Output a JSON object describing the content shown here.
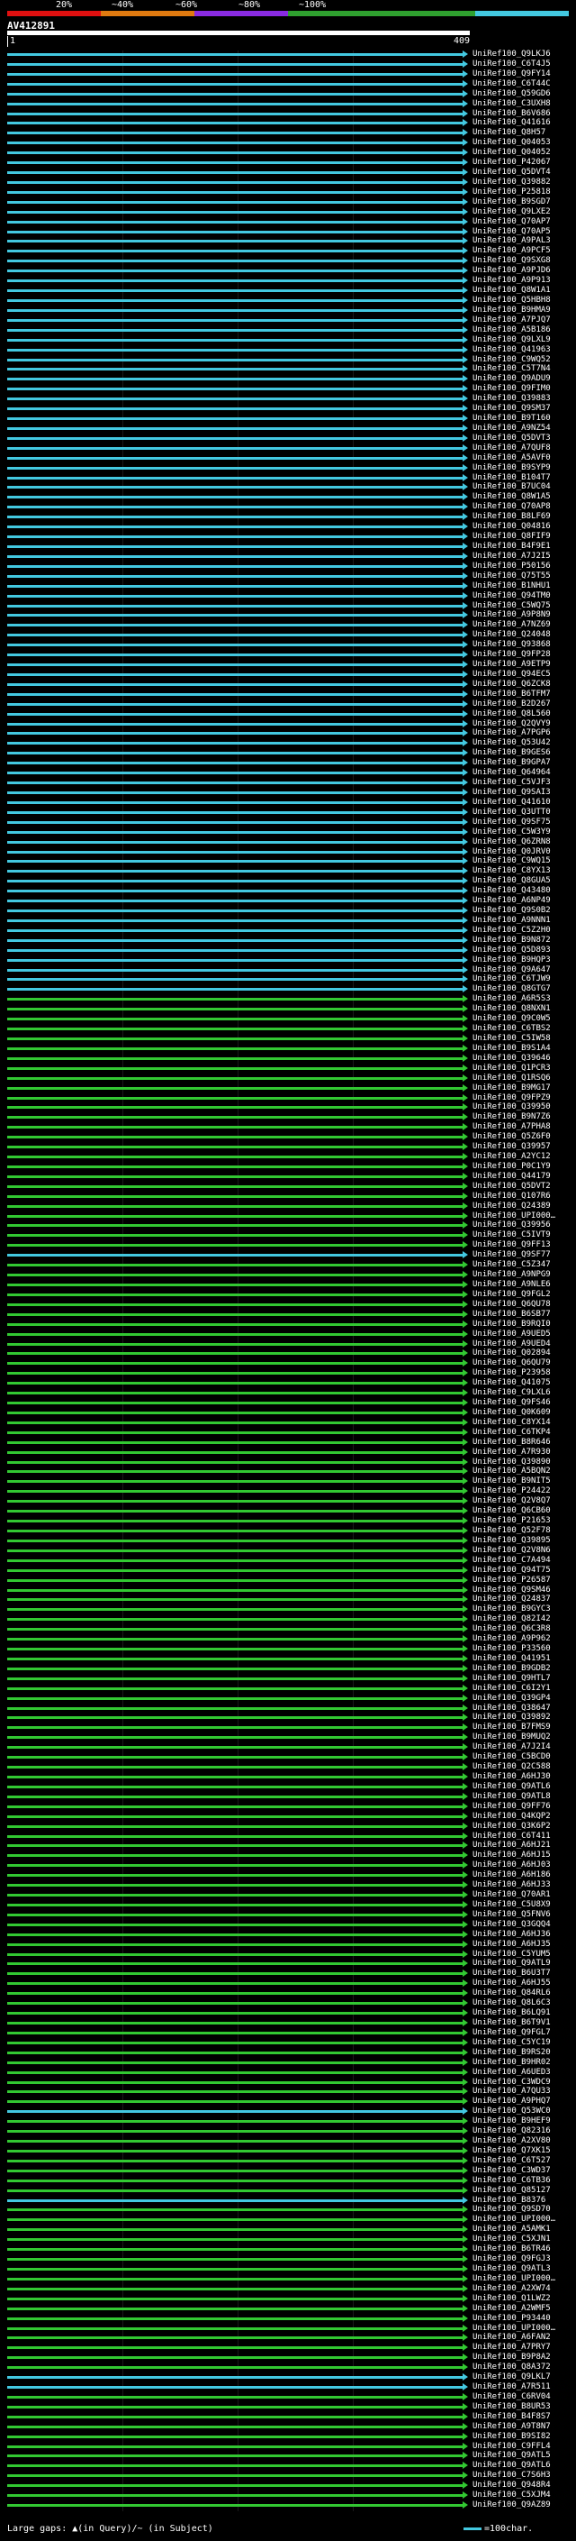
{
  "scale": {
    "labels": [
      "20%",
      "~40%",
      "~60%",
      "~80%",
      "~100%"
    ],
    "colors": [
      "#e01010",
      "#e07a10",
      "#8a2be2",
      "#2fa02f",
      "#2fa02f",
      "#43c8e0"
    ]
  },
  "query": {
    "title": "AV412891",
    "start": "1",
    "end": "409"
  },
  "legend": {
    "left": "Large gaps: ▲(in Query)/~ (in Subject)",
    "right": "=100char."
  },
  "colors": {
    "blue": "#43c8e0",
    "green": "#32c832"
  },
  "hits": [
    {
      "name": "UniRef100_Q9LKJ6",
      "c": "blue"
    },
    {
      "name": "UniRef100_C6T4J5",
      "c": "blue"
    },
    {
      "name": "UniRef100_Q9FY14",
      "c": "blue"
    },
    {
      "name": "UniRef100_C6T44C",
      "c": "blue"
    },
    {
      "name": "UniRef100_Q59GD6",
      "c": "blue"
    },
    {
      "name": "UniRef100_C3UXH8",
      "c": "blue"
    },
    {
      "name": "UniRef100_B6V686",
      "c": "blue"
    },
    {
      "name": "UniRef100_Q41616",
      "c": "blue"
    },
    {
      "name": "UniRef100_Q8H57",
      "c": "blue"
    },
    {
      "name": "UniRef100_Q04053",
      "c": "blue"
    },
    {
      "name": "UniRef100_Q04052",
      "c": "blue"
    },
    {
      "name": "UniRef100_P42067",
      "c": "blue"
    },
    {
      "name": "UniRef100_Q5DVT4",
      "c": "blue"
    },
    {
      "name": "UniRef100_Q39882",
      "c": "blue"
    },
    {
      "name": "UniRef100_P25818",
      "c": "blue"
    },
    {
      "name": "UniRef100_B9SGD7",
      "c": "blue"
    },
    {
      "name": "UniRef100_Q9LXE2",
      "c": "blue"
    },
    {
      "name": "UniRef100_Q70AP7",
      "c": "blue"
    },
    {
      "name": "UniRef100_Q70AP5",
      "c": "blue"
    },
    {
      "name": "UniRef100_A9PAL3",
      "c": "blue"
    },
    {
      "name": "UniRef100_A9PCF5",
      "c": "blue"
    },
    {
      "name": "UniRef100_Q9SXG8",
      "c": "blue"
    },
    {
      "name": "UniRef100_A9PJD6",
      "c": "blue"
    },
    {
      "name": "UniRef100_A9P913",
      "c": "blue"
    },
    {
      "name": "UniRef100_Q8W1A1",
      "c": "blue"
    },
    {
      "name": "UniRef100_Q5HBH8",
      "c": "blue"
    },
    {
      "name": "UniRef100_B9HMA9",
      "c": "blue"
    },
    {
      "name": "UniRef100_A7PJQ7",
      "c": "blue"
    },
    {
      "name": "UniRef100_A5B186",
      "c": "blue"
    },
    {
      "name": "UniRef100_Q9LXL9",
      "c": "blue"
    },
    {
      "name": "UniRef100_Q41963",
      "c": "blue"
    },
    {
      "name": "UniRef100_C9WQ52",
      "c": "blue"
    },
    {
      "name": "UniRef100_C5T7N4",
      "c": "blue"
    },
    {
      "name": "UniRef100_Q9ADU9",
      "c": "blue"
    },
    {
      "name": "UniRef100_Q9FIM0",
      "c": "blue"
    },
    {
      "name": "UniRef100_Q39883",
      "c": "blue"
    },
    {
      "name": "UniRef100_Q9SM37",
      "c": "blue"
    },
    {
      "name": "UniRef100_B9T160",
      "c": "blue"
    },
    {
      "name": "UniRef100_A9NZ54",
      "c": "blue"
    },
    {
      "name": "UniRef100_Q5DVT3",
      "c": "blue"
    },
    {
      "name": "UniRef100_A7QUF8",
      "c": "blue"
    },
    {
      "name": "UniRef100_A5AVF0",
      "c": "blue"
    },
    {
      "name": "UniRef100_B9SYP9",
      "c": "blue"
    },
    {
      "name": "UniRef100_B104T7",
      "c": "blue"
    },
    {
      "name": "UniRef100_B7UC04",
      "c": "blue"
    },
    {
      "name": "UniRef100_Q8W1A5",
      "c": "blue"
    },
    {
      "name": "UniRef100_Q70AP8",
      "c": "blue"
    },
    {
      "name": "UniRef100_B8LF69",
      "c": "blue"
    },
    {
      "name": "UniRef100_Q04816",
      "c": "blue"
    },
    {
      "name": "UniRef100_Q8FIF9",
      "c": "blue"
    },
    {
      "name": "UniRef100_B4F9E1",
      "c": "blue"
    },
    {
      "name": "UniRef100_A7J2I5",
      "c": "blue"
    },
    {
      "name": "UniRef100_P50156",
      "c": "blue"
    },
    {
      "name": "UniRef100_Q75T55",
      "c": "blue"
    },
    {
      "name": "UniRef100_B1NHU1",
      "c": "blue"
    },
    {
      "name": "UniRef100_Q94TM0",
      "c": "blue"
    },
    {
      "name": "UniRef100_C5WQ75",
      "c": "blue"
    },
    {
      "name": "UniRef100_A9P8N9",
      "c": "blue"
    },
    {
      "name": "UniRef100_A7NZ69",
      "c": "blue"
    },
    {
      "name": "UniRef100_Q24048",
      "c": "blue"
    },
    {
      "name": "UniRef100_Q93868",
      "c": "blue"
    },
    {
      "name": "UniRef100_Q9FP28",
      "c": "blue"
    },
    {
      "name": "UniRef100_A9ETP9",
      "c": "blue"
    },
    {
      "name": "UniRef100_Q94EC5",
      "c": "blue"
    },
    {
      "name": "UniRef100_Q6ZCK8",
      "c": "blue"
    },
    {
      "name": "UniRef100_B6TFM7",
      "c": "blue"
    },
    {
      "name": "UniRef100_B2D267",
      "c": "blue"
    },
    {
      "name": "UniRef100_Q8L560",
      "c": "blue"
    },
    {
      "name": "UniRef100_Q2QVY9",
      "c": "blue"
    },
    {
      "name": "UniRef100_A7PGP6",
      "c": "blue"
    },
    {
      "name": "UniRef100_Q53U42",
      "c": "blue"
    },
    {
      "name": "UniRef100_B9GES6",
      "c": "blue"
    },
    {
      "name": "UniRef100_B9GPA7",
      "c": "blue"
    },
    {
      "name": "UniRef100_Q64964",
      "c": "blue"
    },
    {
      "name": "UniRef100_C5VJF3",
      "c": "blue"
    },
    {
      "name": "UniRef100_Q9SAI3",
      "c": "blue"
    },
    {
      "name": "UniRef100_Q41610",
      "c": "blue"
    },
    {
      "name": "UniRef100_Q3UTT0",
      "c": "blue"
    },
    {
      "name": "UniRef100_Q9SF75",
      "c": "blue"
    },
    {
      "name": "UniRef100_C5W3Y9",
      "c": "blue"
    },
    {
      "name": "UniRef100_Q6ZRN8",
      "c": "blue"
    },
    {
      "name": "UniRef100_Q0JRV0",
      "c": "blue"
    },
    {
      "name": "UniRef100_C9WQ15",
      "c": "blue"
    },
    {
      "name": "UniRef100_C8YX13",
      "c": "blue"
    },
    {
      "name": "UniRef100_Q8GUA5",
      "c": "blue"
    },
    {
      "name": "UniRef100_Q43480",
      "c": "blue"
    },
    {
      "name": "UniRef100_A6NP49",
      "c": "blue"
    },
    {
      "name": "UniRef100_Q9S0B2",
      "c": "blue"
    },
    {
      "name": "UniRef100_A9NNN1",
      "c": "blue"
    },
    {
      "name": "UniRef100_C5Z2H0",
      "c": "blue"
    },
    {
      "name": "UniRef100_B9N872",
      "c": "blue"
    },
    {
      "name": "UniRef100_Q5D893",
      "c": "blue"
    },
    {
      "name": "UniRef100_B9HQP3",
      "c": "blue"
    },
    {
      "name": "UniRef100_Q9A647",
      "c": "blue"
    },
    {
      "name": "UniRef100_C6TJW9",
      "c": "blue"
    },
    {
      "name": "UniRef100_Q8GTG7",
      "c": "blue"
    },
    {
      "name": "UniRef100_A6R5S3",
      "c": "green"
    },
    {
      "name": "UniRef100_Q8NXN1",
      "c": "green"
    },
    {
      "name": "UniRef100_Q9C0W5",
      "c": "green"
    },
    {
      "name": "UniRef100_C6TBS2",
      "c": "green"
    },
    {
      "name": "UniRef100_C5IW58",
      "c": "green"
    },
    {
      "name": "UniRef100_B9S1A4",
      "c": "green"
    },
    {
      "name": "UniRef100_Q39646",
      "c": "green"
    },
    {
      "name": "UniRef100_Q1PCR3",
      "c": "green"
    },
    {
      "name": "UniRef100_Q1RSQ6",
      "c": "green"
    },
    {
      "name": "UniRef100_B9MG17",
      "c": "green"
    },
    {
      "name": "UniRef100_Q9FPZ9",
      "c": "green"
    },
    {
      "name": "UniRef100_Q39950",
      "c": "green"
    },
    {
      "name": "UniRef100_B9N7Z6",
      "c": "green"
    },
    {
      "name": "UniRef100_A7PHA8",
      "c": "green"
    },
    {
      "name": "UniRef100_Q5Z6F0",
      "c": "green"
    },
    {
      "name": "UniRef100_Q39957",
      "c": "green"
    },
    {
      "name": "UniRef100_A2YC12",
      "c": "green"
    },
    {
      "name": "UniRef100_P0C1Y9",
      "c": "green"
    },
    {
      "name": "UniRef100_Q44179",
      "c": "green"
    },
    {
      "name": "UniRef100_Q5DVT2",
      "c": "green"
    },
    {
      "name": "UniRef100_Q107R6",
      "c": "green"
    },
    {
      "name": "UniRef100_Q24389",
      "c": "green"
    },
    {
      "name": "UniRef100_UPI000…",
      "c": "green"
    },
    {
      "name": "UniRef100_Q39956",
      "c": "green"
    },
    {
      "name": "UniRef100_C5IVT9",
      "c": "green"
    },
    {
      "name": "UniRef100_Q9FF13",
      "c": "green"
    },
    {
      "name": "UniRef100_Q9SF77",
      "c": "blue"
    },
    {
      "name": "UniRef100_C5Z347",
      "c": "green"
    },
    {
      "name": "UniRef100_A9NPG9",
      "c": "green"
    },
    {
      "name": "UniRef100_A9NLE6",
      "c": "green"
    },
    {
      "name": "UniRef100_Q9FGL2",
      "c": "green"
    },
    {
      "name": "UniRef100_Q6QU78",
      "c": "green"
    },
    {
      "name": "UniRef100_B6SB77",
      "c": "green"
    },
    {
      "name": "UniRef100_B9RQI0",
      "c": "green"
    },
    {
      "name": "UniRef100_A9UED5",
      "c": "green"
    },
    {
      "name": "UniRef100_A9UED4",
      "c": "green"
    },
    {
      "name": "UniRef100_Q02894",
      "c": "green"
    },
    {
      "name": "UniRef100_Q6QU79",
      "c": "green"
    },
    {
      "name": "UniRef100_P23958",
      "c": "green"
    },
    {
      "name": "UniRef100_Q41075",
      "c": "green"
    },
    {
      "name": "UniRef100_C9LXL6",
      "c": "green"
    },
    {
      "name": "UniRef100_Q9FS46",
      "c": "green"
    },
    {
      "name": "UniRef100_Q0K609",
      "c": "green"
    },
    {
      "name": "UniRef100_C8YX14",
      "c": "green"
    },
    {
      "name": "UniRef100_C6TKP4",
      "c": "green"
    },
    {
      "name": "UniRef100_B8R646",
      "c": "green"
    },
    {
      "name": "UniRef100_A7R930",
      "c": "green"
    },
    {
      "name": "UniRef100_Q39890",
      "c": "green"
    },
    {
      "name": "UniRef100_A5BQN2",
      "c": "green"
    },
    {
      "name": "UniRef100_B9NIT5",
      "c": "green"
    },
    {
      "name": "UniRef100_P24422",
      "c": "green"
    },
    {
      "name": "UniRef100_Q2V8Q7",
      "c": "green"
    },
    {
      "name": "UniRef100_Q6CB60",
      "c": "green"
    },
    {
      "name": "UniRef100_P21653",
      "c": "green"
    },
    {
      "name": "UniRef100_Q52F78",
      "c": "green"
    },
    {
      "name": "UniRef100_Q39895",
      "c": "green"
    },
    {
      "name": "UniRef100_Q2V8N6",
      "c": "green"
    },
    {
      "name": "UniRef100_C7A494",
      "c": "green"
    },
    {
      "name": "UniRef100_Q94T75",
      "c": "green"
    },
    {
      "name": "UniRef100_P26587",
      "c": "green"
    },
    {
      "name": "UniRef100_Q9SM46",
      "c": "green"
    },
    {
      "name": "UniRef100_Q24837",
      "c": "green"
    },
    {
      "name": "UniRef100_B9GYC3",
      "c": "green"
    },
    {
      "name": "UniRef100_Q82I42",
      "c": "green"
    },
    {
      "name": "UniRef100_Q6C3R8",
      "c": "green"
    },
    {
      "name": "UniRef100_A9P962",
      "c": "green"
    },
    {
      "name": "UniRef100_P33560",
      "c": "green"
    },
    {
      "name": "UniRef100_Q41951",
      "c": "green"
    },
    {
      "name": "UniRef100_B9GDB2",
      "c": "green"
    },
    {
      "name": "UniRef100_Q9HTL7",
      "c": "green"
    },
    {
      "name": "UniRef100_C6I2Y1",
      "c": "green"
    },
    {
      "name": "UniRef100_Q39GP4",
      "c": "green"
    },
    {
      "name": "UniRef100_Q38647",
      "c": "green"
    },
    {
      "name": "UniRef100_Q39892",
      "c": "green"
    },
    {
      "name": "UniRef100_B7FMS9",
      "c": "green"
    },
    {
      "name": "UniRef100_B9MUQ2",
      "c": "green"
    },
    {
      "name": "UniRef100_A7J2I4",
      "c": "green"
    },
    {
      "name": "UniRef100_C5BCD0",
      "c": "green"
    },
    {
      "name": "UniRef100_Q2C588",
      "c": "green"
    },
    {
      "name": "UniRef100_A6HJ30",
      "c": "green"
    },
    {
      "name": "UniRef100_Q9ATL6",
      "c": "green"
    },
    {
      "name": "UniRef100_Q9ATL8",
      "c": "green"
    },
    {
      "name": "UniRef100_Q9FF76",
      "c": "green"
    },
    {
      "name": "UniRef100_Q4KQP2",
      "c": "green"
    },
    {
      "name": "UniRef100_Q3K6P2",
      "c": "green"
    },
    {
      "name": "UniRef100_C6T411",
      "c": "green"
    },
    {
      "name": "UniRef100_A6HJ21",
      "c": "green"
    },
    {
      "name": "UniRef100_A6HJ15",
      "c": "green"
    },
    {
      "name": "UniRef100_A6HJ03",
      "c": "green"
    },
    {
      "name": "UniRef100_A6H186",
      "c": "green"
    },
    {
      "name": "UniRef100_A6HJ33",
      "c": "green"
    },
    {
      "name": "UniRef100_Q70AR1",
      "c": "green"
    },
    {
      "name": "UniRef100_C5U8X9",
      "c": "green"
    },
    {
      "name": "UniRef100_Q5FNV6",
      "c": "green"
    },
    {
      "name": "UniRef100_Q3GQQ4",
      "c": "green"
    },
    {
      "name": "UniRef100_A6HJ36",
      "c": "green"
    },
    {
      "name": "UniRef100_A6HJ35",
      "c": "green"
    },
    {
      "name": "UniRef100_C5YUM5",
      "c": "green"
    },
    {
      "name": "UniRef100_Q9ATL9",
      "c": "green"
    },
    {
      "name": "UniRef100_B6U3T7",
      "c": "green"
    },
    {
      "name": "UniRef100_A6HJ55",
      "c": "green"
    },
    {
      "name": "UniRef100_Q84RL6",
      "c": "green"
    },
    {
      "name": "UniRef100_Q8L6C3",
      "c": "green"
    },
    {
      "name": "UniRef100_B6LQ91",
      "c": "green"
    },
    {
      "name": "UniRef100_B6T9V1",
      "c": "green"
    },
    {
      "name": "UniRef100_Q9FGL7",
      "c": "green"
    },
    {
      "name": "UniRef100_C5YC19",
      "c": "green"
    },
    {
      "name": "UniRef100_B9RS20",
      "c": "green"
    },
    {
      "name": "UniRef100_B9HR02",
      "c": "green"
    },
    {
      "name": "UniRef100_A6UED3",
      "c": "green"
    },
    {
      "name": "UniRef100_C3WDC9",
      "c": "green"
    },
    {
      "name": "UniRef100_A7QU33",
      "c": "green"
    },
    {
      "name": "UniRef100_A9PHQ7",
      "c": "green"
    },
    {
      "name": "UniRef100_Q53WC0",
      "c": "blue"
    },
    {
      "name": "UniRef100_B9HEF9",
      "c": "green"
    },
    {
      "name": "UniRef100_Q82316",
      "c": "green"
    },
    {
      "name": "UniRef100_A2XV80",
      "c": "green"
    },
    {
      "name": "UniRef100_Q7XK15",
      "c": "green"
    },
    {
      "name": "UniRef100_C6T527",
      "c": "green"
    },
    {
      "name": "UniRef100_C3WD37",
      "c": "green"
    },
    {
      "name": "UniRef100_C6TB36",
      "c": "green"
    },
    {
      "name": "UniRef100_Q85127",
      "c": "green"
    },
    {
      "name": "UniRef100_B8376",
      "c": "blue"
    },
    {
      "name": "UniRef100_Q9SD70",
      "c": "green"
    },
    {
      "name": "UniRef100_UPI000…",
      "c": "green"
    },
    {
      "name": "UniRef100_A5AMK1",
      "c": "green"
    },
    {
      "name": "UniRef100_C5XJN1",
      "c": "green"
    },
    {
      "name": "UniRef100_B6TR46",
      "c": "green"
    },
    {
      "name": "UniRef100_Q9FGJ3",
      "c": "green"
    },
    {
      "name": "UniRef100_Q9ATL3",
      "c": "green"
    },
    {
      "name": "UniRef100_UPI000…",
      "c": "green"
    },
    {
      "name": "UniRef100_A2XW74",
      "c": "green"
    },
    {
      "name": "UniRef100_Q1LWZ2",
      "c": "green"
    },
    {
      "name": "UniRef100_A2WMF5",
      "c": "green"
    },
    {
      "name": "UniRef100_P93440",
      "c": "green"
    },
    {
      "name": "UniRef100_UPI000…",
      "c": "green"
    },
    {
      "name": "UniRef100_A6FAN2",
      "c": "green"
    },
    {
      "name": "UniRef100_A7PRY7",
      "c": "green"
    },
    {
      "name": "UniRef100_B9P8A2",
      "c": "green"
    },
    {
      "name": "UniRef100_Q8A372",
      "c": "green"
    },
    {
      "name": "UniRef100_Q9LKL7",
      "c": "blue"
    },
    {
      "name": "UniRef100_A7R511",
      "c": "blue"
    },
    {
      "name": "UniRef100_C6RV04",
      "c": "green"
    },
    {
      "name": "UniRef100_B8UR53",
      "c": "green"
    },
    {
      "name": "UniRef100_B4F8S7",
      "c": "green"
    },
    {
      "name": "UniRef100_A9T8N7",
      "c": "green"
    },
    {
      "name": "UniRef100_B9SI82",
      "c": "green"
    },
    {
      "name": "UniRef100_C9FFL4",
      "c": "green"
    },
    {
      "name": "UniRef100_Q9ATL5",
      "c": "green"
    },
    {
      "name": "UniRef100_Q9ATL6",
      "c": "green"
    },
    {
      "name": "UniRef100_C7S6H3",
      "c": "green"
    },
    {
      "name": "UniRef100_Q948R4",
      "c": "green"
    },
    {
      "name": "UniRef100_C5XJM4",
      "c": "green"
    },
    {
      "name": "UniRef100_Q9AZ89",
      "c": "green"
    }
  ]
}
